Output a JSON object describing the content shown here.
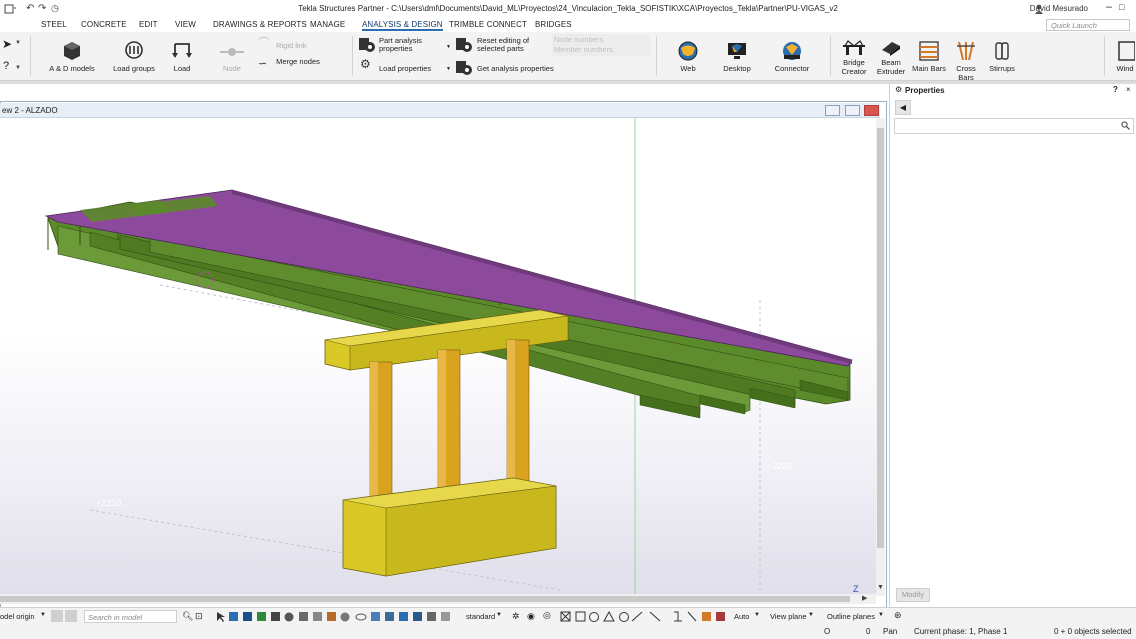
{
  "titlebar": {
    "title": "Tekla Structures Partner - C:\\Users\\dml\\Documents\\David_ML\\Proyectos\\24_Vinculacion_Tekla_SOFISTIK\\XCA\\Proyectos_Tekla\\Partner\\PU-VIGAS_v2",
    "user": "David Mesurado",
    "quick_launch_placeholder": "Quick Launch"
  },
  "menu": {
    "tabs": [
      "STEEL",
      "CONCRETE",
      "EDIT",
      "VIEW",
      "DRAWINGS & REPORTS",
      "MANAGE",
      "ANALYSIS & DESIGN",
      "TRIMBLE CONNECT",
      "BRIDGES"
    ],
    "active": "ANALYSIS & DESIGN"
  },
  "ribbon": {
    "ad_models": "A & D models",
    "load_groups": "Load groups",
    "load": "Load",
    "node": "Node",
    "rigid_link": "Rigid link",
    "merge_nodes": "Merge nodes",
    "part_analysis_properties_1": "Part analysis",
    "part_analysis_properties_2": "properties",
    "load_properties": "Load properties",
    "reset_editing_1": "Reset editing of",
    "reset_editing_2": "selected parts",
    "get_analysis_properties": "Get analysis properties",
    "node_numbers": "Node numbers",
    "member_numbers": "Member numbers",
    "web": "Web",
    "desktop": "Desktop",
    "connector": "Connector",
    "bridge_creator_1": "Bridge",
    "bridge_creator_2": "Creator",
    "beam_extruder_1": "Beam",
    "beam_extruder_2": "Extruder",
    "main_bars": "Main Bars",
    "cross_bars": "Cross Bars",
    "stirrups": "Stirrups",
    "window": "Wind"
  },
  "view": {
    "title": "ew 2 - ALZADO",
    "elevation_labels": [
      "+2210",
      "+2220",
      "+2210"
    ],
    "axis_label": "Z"
  },
  "properties": {
    "title": "Properties",
    "modify": "Modify"
  },
  "bottombar": {
    "model_origin": "odel origin",
    "search_placeholder": "Search in model",
    "standard": "standard",
    "auto": "Auto",
    "view_plane": "View plane",
    "outline_planes": "Outline planes"
  },
  "statusbar": {
    "o_label": "O",
    "zero": "0",
    "pan": "Pan",
    "phase": "Current phase: 1, Phase 1",
    "selected": "0 + 0 objects selected"
  },
  "colors": {
    "beam_green": "#5e8a2b",
    "deck_purple": "#8d4a9c",
    "pier_yellow": "#d9c825",
    "column_orange": "#d9a21f",
    "accent_blue": "#2a6db0"
  }
}
